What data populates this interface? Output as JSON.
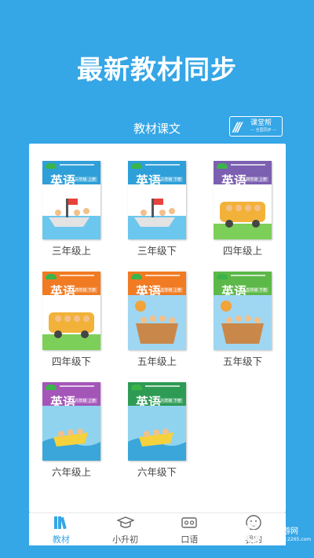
{
  "header": {
    "headline": "最新教材同步",
    "section_title": "教材课文",
    "brand": {
      "main": "课堂帮",
      "sub": "— 全国同步 —",
      "mark": "///"
    }
  },
  "books": [
    {
      "label": "三年级上",
      "title": "英语",
      "grade_tag": "三年级 上册",
      "cover_color": "#2e9fd8",
      "scene": "boat"
    },
    {
      "label": "三年级下",
      "title": "英语",
      "grade_tag": "三年级 下册",
      "cover_color": "#2e9fd8",
      "scene": "boat"
    },
    {
      "label": "四年级上",
      "title": "英语",
      "grade_tag": "四年级 上册",
      "cover_color": "#7b5fb0",
      "scene": "bus"
    },
    {
      "label": "四年级下",
      "title": "英语",
      "grade_tag": "四年级 下册",
      "cover_color": "#f07b23",
      "scene": "bus"
    },
    {
      "label": "五年级上",
      "title": "英语",
      "grade_tag": "五年级 上册",
      "cover_color": "#f07b23",
      "scene": "balloon"
    },
    {
      "label": "五年级下",
      "title": "英语",
      "grade_tag": "五年级 下册",
      "cover_color": "#5cb848",
      "scene": "balloon"
    },
    {
      "label": "六年级上",
      "title": "英语",
      "grade_tag": "六年级 上册",
      "cover_color": "#a455b8",
      "scene": "water"
    },
    {
      "label": "六年级下",
      "title": "英语",
      "grade_tag": "六年级 下册",
      "cover_color": "#2e9b55",
      "scene": "water"
    }
  ],
  "tabs": [
    {
      "label": "教材",
      "icon": "books-icon",
      "active": true
    },
    {
      "label": "小升初",
      "icon": "graduation-cap-icon",
      "active": false
    },
    {
      "label": "口语",
      "icon": "cassette-icon",
      "active": false
    },
    {
      "label": "我的",
      "icon": "smile-face-icon",
      "active": false
    }
  ],
  "watermark": {
    "logo": "2265",
    "name": "手游网",
    "url": "www.2265.com"
  },
  "colors": {
    "accent": "#35a6e6",
    "panel": "#ffffff",
    "label_text": "#444444"
  }
}
